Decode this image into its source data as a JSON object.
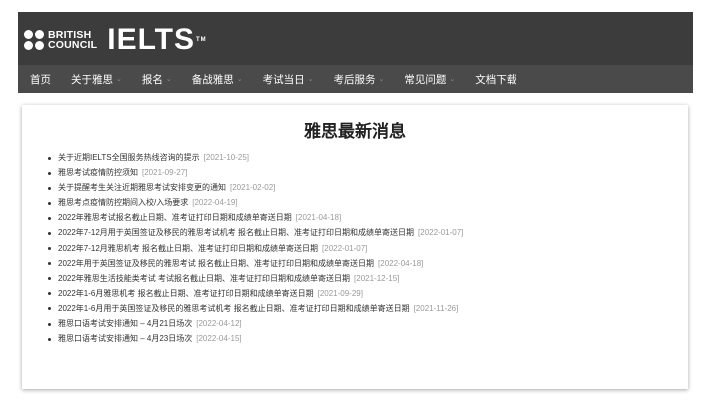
{
  "header": {
    "brand_line1": "BRITISH",
    "brand_line2": "COUNCIL",
    "product": "IELTS",
    "trademark": "TM"
  },
  "nav": {
    "items": [
      {
        "label": "首页",
        "dropdown": false
      },
      {
        "label": "关于雅思",
        "dropdown": true
      },
      {
        "label": "报名",
        "dropdown": true
      },
      {
        "label": "备战雅思",
        "dropdown": true
      },
      {
        "label": "考试当日",
        "dropdown": true
      },
      {
        "label": "考后服务",
        "dropdown": true
      },
      {
        "label": "常见问题",
        "dropdown": true
      },
      {
        "label": "文档下载",
        "dropdown": false
      }
    ],
    "caret": "⌄"
  },
  "news": {
    "title": "雅思最新消息",
    "items": [
      {
        "text": "关于近期IELTS全国服务热线咨询的提示",
        "date": "[2021-10-25]"
      },
      {
        "text": "雅思考试疫情防控须知",
        "date": "[2021-09-27]"
      },
      {
        "text": "关于提醒考生关注近期雅思考试安排变更的通知",
        "date": "[2021-02-02]"
      },
      {
        "text": "雅思考点疫情防控期间入校/入场要求",
        "date": "[2022-04-19]"
      },
      {
        "text": "2022年雅思考试报名截止日期、准考证打印日期和成绩单寄送日期",
        "date": "[2021-04-18]"
      },
      {
        "text": "2022年7-12月用于英国签证及移民的雅思考试机考 报名截止日期、准考证打印日期和成绩单寄送日期",
        "date": "[2022-01-07]"
      },
      {
        "text": "2022年7-12月雅思机考 报名截止日期、准考证打印日期和成绩单寄送日期",
        "date": "[2022-01-07]"
      },
      {
        "text": "2022年用于英国签证及移民的雅思考试 报名截止日期、准考证打印日期和成绩单寄送日期",
        "date": "[2022-04-18]"
      },
      {
        "text": "2022年雅思生活技能类考试 考试报名截止日期、准考证打印日期和成绩单寄送日期",
        "date": "[2021-12-15]"
      },
      {
        "text": "2022年1-6月雅思机考 报名截止日期、准考证打印日期和成绩单寄送日期",
        "date": "[2021-09-29]"
      },
      {
        "text": "2022年1-6月用于英国签证及移民的雅思考试机考 报名截止日期、准考证打印日期和成绩单寄送日期",
        "date": "[2021-11-26]"
      },
      {
        "text": "雅思口语考试安排通知 – 4月21日场次",
        "date": "[2022-04-12]"
      },
      {
        "text": "雅思口语考试安排通知 – 4月23日场次",
        "date": "[2022-04-15]"
      }
    ]
  }
}
